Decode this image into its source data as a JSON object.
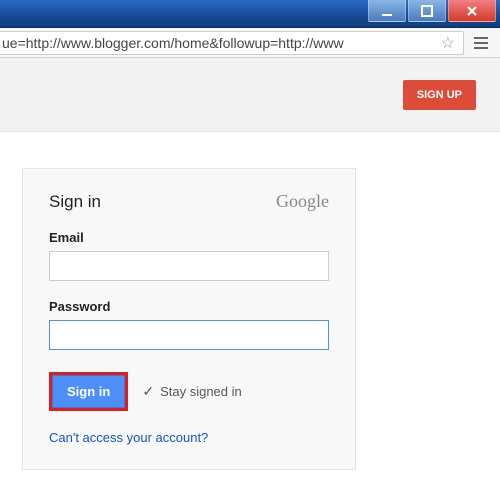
{
  "browser": {
    "url_visible": "ue=http://www.blogger.com/home&followup=http://www"
  },
  "header": {
    "signup_label": "SIGN UP"
  },
  "signin": {
    "title": "Sign in",
    "logo": "Google",
    "email_label": "Email",
    "email_value": "",
    "password_label": "Password",
    "password_value": "",
    "submit_label": "Sign in",
    "stay_label": "Stay signed in",
    "stay_checked": true,
    "help_link": "Can't access your account?"
  },
  "colors": {
    "accent_red": "#dd4b39",
    "accent_blue": "#4d8ff9",
    "highlight_border": "#e31b1b"
  }
}
